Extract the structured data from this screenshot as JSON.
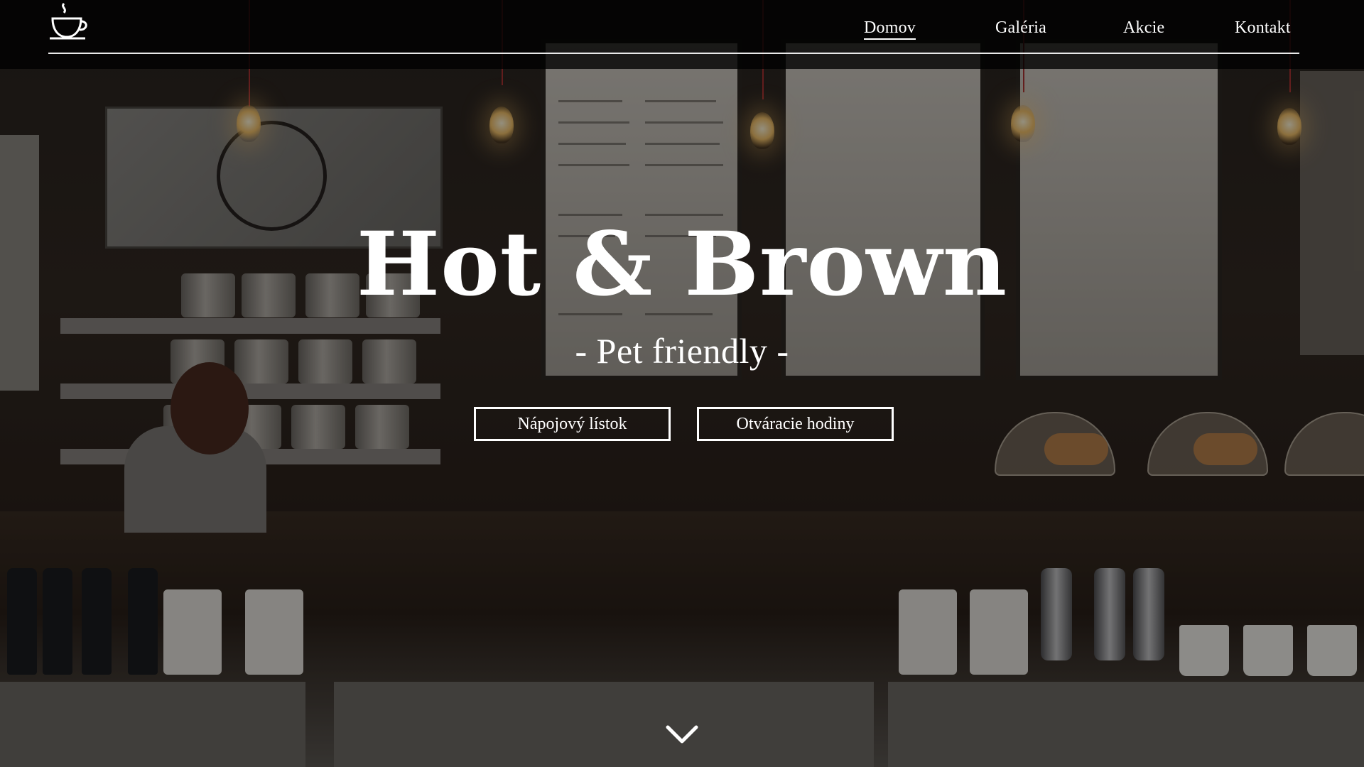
{
  "header": {
    "logo": "coffee-cup-icon",
    "nav": [
      {
        "label": "Domov",
        "active": true
      },
      {
        "label": "Galéria",
        "active": false
      },
      {
        "label": "Akcie",
        "active": false
      },
      {
        "label": "Kontakt",
        "active": false
      }
    ]
  },
  "hero": {
    "title": "Hot & Brown",
    "subtitle": "- Pet friendly -",
    "buttons": [
      {
        "label": "Nápojový lístok"
      },
      {
        "label": "Otváracie hodiny"
      }
    ],
    "scroll_icon": "chevron-down-icon"
  },
  "colors": {
    "nav_background": "#000000",
    "text": "#ffffff",
    "button_border": "#ffffff"
  }
}
